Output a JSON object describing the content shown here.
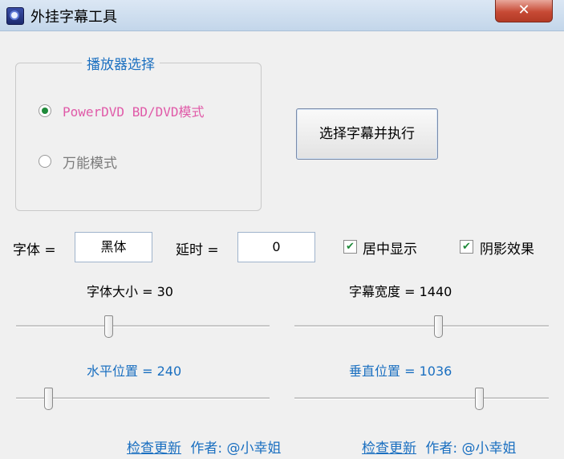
{
  "window": {
    "title": "外挂字幕工具",
    "close_label": "✕"
  },
  "player_group": {
    "title": "播放器选择",
    "options": [
      {
        "label": "PowerDVD BD/DVD模式",
        "checked": true
      },
      {
        "label": "万能模式",
        "checked": false
      }
    ]
  },
  "execute_button": {
    "label": "选择字幕并执行"
  },
  "font": {
    "label": "字体 =",
    "value": "黑体"
  },
  "delay": {
    "label": "延时 =",
    "value": "0"
  },
  "center_display": {
    "label": "居中显示",
    "checked": true
  },
  "shadow_effect": {
    "label": "阴影效果",
    "checked": true
  },
  "sliders": {
    "font_size": {
      "label": "字体大小 = 30",
      "value": 30
    },
    "subtitle_width": {
      "label": "字幕宽度 = 1440",
      "value": 1440
    },
    "horizontal_position": {
      "label": "水平位置 = 240",
      "value": 240
    },
    "vertical_position": {
      "label": "垂直位置 = 1036",
      "value": 1036
    }
  },
  "footer": {
    "link1": "检查更新",
    "author1": "作者: @小幸姐",
    "link2": "检查更新",
    "author2": "作者: @小幸姐"
  },
  "colors": {
    "accent": "#1a6fc0",
    "radio_fill": "#1f8a3a",
    "close_red": "#c74a35"
  }
}
